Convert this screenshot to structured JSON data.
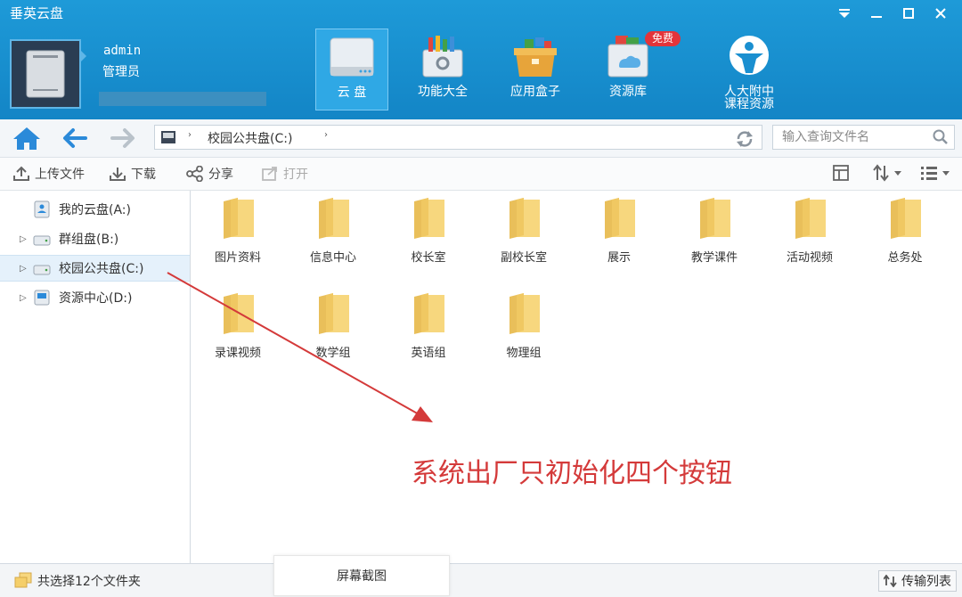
{
  "app": {
    "title": "垂英云盘"
  },
  "window_controls": [
    "▼",
    "—",
    "☐",
    "✕"
  ],
  "user": {
    "name": "admin",
    "role": "管理员"
  },
  "nav": [
    {
      "label": "云 盘",
      "icon": "cloud-disk-icon",
      "active": true
    },
    {
      "label": "功能大全",
      "icon": "toolbox-icon",
      "active": false
    },
    {
      "label": "应用盒子",
      "icon": "app-box-icon",
      "active": false
    },
    {
      "label": "资源库",
      "icon": "resource-library-icon",
      "active": false,
      "badge": "免费"
    },
    {
      "label_line1": "人大附中",
      "label_line2": "课程资源",
      "icon": "school-logo-icon",
      "active": false
    }
  ],
  "address": {
    "path": "校园公共盘(C:)",
    "sep": "›"
  },
  "search": {
    "placeholder": "输入查询文件名"
  },
  "toolbar": {
    "upload": "上传文件",
    "download": "下载",
    "share": "分享",
    "open": "打开"
  },
  "sidebar": {
    "items": [
      {
        "label": "我的云盘(A:)",
        "expandable": false
      },
      {
        "label": "群组盘(B:)",
        "expandable": true
      },
      {
        "label": "校园公共盘(C:)",
        "expandable": true,
        "selected": true
      },
      {
        "label": "资源中心(D:)",
        "expandable": true
      }
    ]
  },
  "folders": [
    "图片资料",
    "信息中心",
    "校长室",
    "副校长室",
    "展示",
    "教学课件",
    "活动视频",
    "总务处",
    "录课视频",
    "数学组",
    "英语组",
    "物理组"
  ],
  "annotation": {
    "text": "系统出厂只初始化四个按钮",
    "color": "#d43a3a"
  },
  "status": {
    "selection": "共选择12个文件夹",
    "screenshot_tab": "屏幕截图",
    "transfer_list": "传输列表"
  },
  "colors": {
    "header": "#1a8fd0",
    "folder": "#f5d173",
    "accent": "#2b8ad9"
  }
}
